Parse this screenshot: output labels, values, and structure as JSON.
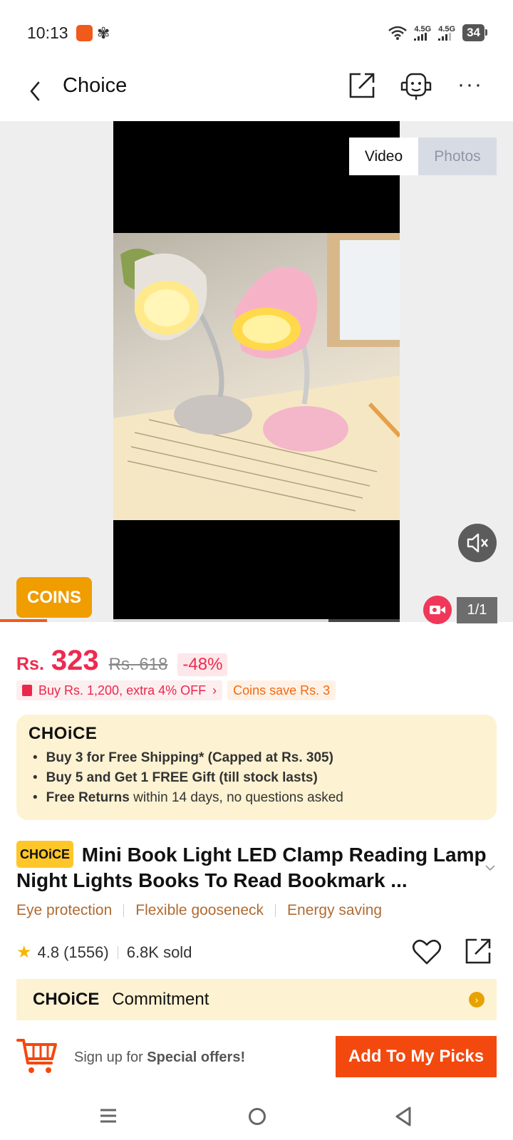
{
  "status_bar": {
    "time": "10:13",
    "network1": "4.5G",
    "network2": "4.5G",
    "battery": "34"
  },
  "header": {
    "title": "Choice"
  },
  "media": {
    "tab_video": "Video",
    "tab_photos": "Photos",
    "coins_label": "COINS",
    "counter": "1/1"
  },
  "price": {
    "currency": "Rs.",
    "current": "323",
    "original": "Rs. 618",
    "discount": "-48%",
    "promo_bundle": "Buy Rs. 1,200, extra 4% OFF",
    "promo_coins": "Coins save Rs. 3"
  },
  "choice_box": {
    "logo": "CHOiCE",
    "benefit1": "Buy 3 for  Free Shipping* (Capped at Rs. 305)",
    "benefit2": "Buy 5 and Get 1 FREE Gift (till stock lasts)",
    "benefit3_bold": "Free Returns",
    "benefit3_rest": " within 14 days, no questions asked"
  },
  "product": {
    "tag": "CHOiCE",
    "title": "Mini Book Light LED Clamp Reading Lamp Night Lights Books To Read Bookmark ...",
    "features": [
      "Eye protection",
      "Flexible gooseneck",
      "Energy saving"
    ],
    "rating": "4.8",
    "reviews": "(1556)",
    "sold": "6.8K sold"
  },
  "commitment": {
    "logo": "CHOiCE",
    "label": "Commitment"
  },
  "action_bar": {
    "signup_prefix": "Sign up for ",
    "signup_bold": "Special offers!",
    "picks_button": "Add To My Picks"
  },
  "colors": {
    "accent": "#f3490f",
    "price_red": "#ee2a4e",
    "choice_bg": "#fdf2d2",
    "coins": "#f09d00"
  }
}
